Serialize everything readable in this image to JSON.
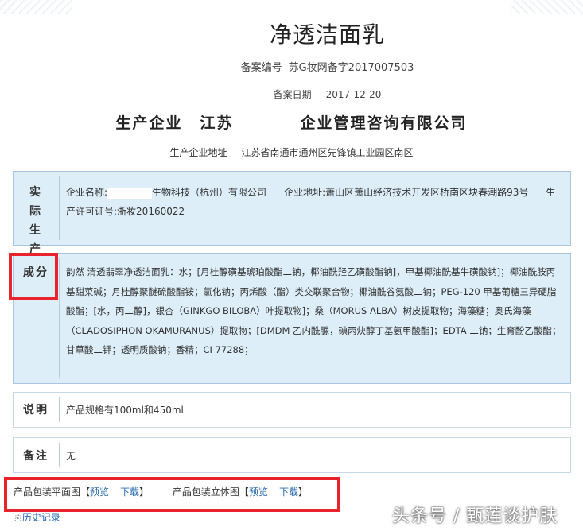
{
  "product_title": "净透洁面乳",
  "registration": {
    "label": "备案编号",
    "value": "苏G妆网备字2017007503"
  },
  "record_date": {
    "label": "备案日期",
    "value": "2017-12-20"
  },
  "producer": {
    "label": "生产企业",
    "name_prefix": "江苏",
    "name_suffix": "企业管理咨询有限公司"
  },
  "producer_address": {
    "label": "生产企业地址",
    "value": "江苏省南通市通州区先锋镇工业园区南区"
  },
  "actual_producer": {
    "label": "实际生产企业",
    "company_label": "企业名称:",
    "company_name": "生物科技（杭州）有限公司",
    "address_label": "企业地址:",
    "address_value": "萧山区萧山经济技术开发区桥南区块春潮路93号",
    "license_label": "生产许可证号:",
    "license_value": "浙妆20160022"
  },
  "ingredients": {
    "label": "成分",
    "text": "韵然 清透翡翠净透洁面乳：水；[月桂醇磺基琥珀酸酯二钠，椰油酰羟乙磺酸酯钠]，甲基椰油酰基牛磺酸钠]；椰油酰胺丙基甜菜碱；月桂醇聚醚硫酸酯铵；氯化钠；丙烯酸（酯）类交联聚合物；椰油酰谷氨酸二钠；PEG-120 甲基葡糖三异硬脂酸酯；[水，丙二醇]，银杏（GINKGO BILOBA）叶提取物]；桑（MORUS ALBA）树皮提取物；海藻糖；奥氏海藻（CLADOSIPHON OKAMURANUS）提取物；[DMDM 乙内酰脲，碘丙炔醇丁基氨甲酸酯]；EDTA 二钠；生育酚乙酸酯；甘草酸二钾；透明质酸钠；香精；CI 77288；"
  },
  "description": {
    "label": "说明",
    "text": "产品规格有100ml和450ml"
  },
  "remark": {
    "label": "备注",
    "text": "无"
  },
  "packaging": {
    "flat": {
      "label": "产品包装平面图",
      "preview": "预览",
      "download": "下载"
    },
    "solid": {
      "label": "产品包装立体图",
      "preview": "预览",
      "download": "下载"
    }
  },
  "history": {
    "label": "历史记录",
    "icon": "history-icon"
  },
  "watermark": "头条号 / 甄莲谈护肤",
  "colors": {
    "highlight": "#e8232b",
    "panel_bg": "#ddeef9",
    "link": "#2a6cb0"
  }
}
